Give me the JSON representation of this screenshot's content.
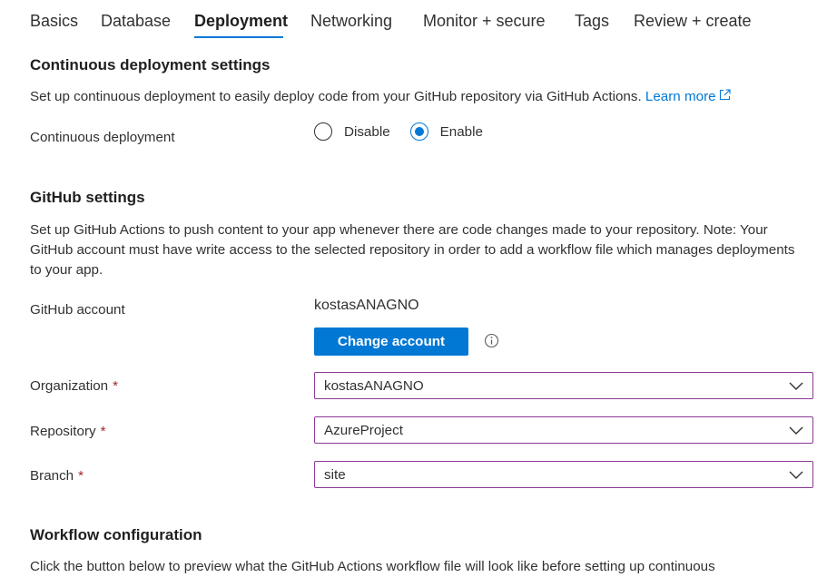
{
  "tabs": [
    {
      "label": "Basics"
    },
    {
      "label": "Database"
    },
    {
      "label": "Deployment"
    },
    {
      "label": "Networking"
    },
    {
      "label": "Monitor + secure"
    },
    {
      "label": "Tags"
    },
    {
      "label": "Review + create"
    }
  ],
  "active_tab": "Deployment",
  "accent_color": "#0078d4",
  "continuous_deployment": {
    "title": "Continuous deployment settings",
    "description": "Set up continuous deployment to easily deploy code from your GitHub repository via GitHub Actions.",
    "learn_more": "Learn more",
    "label": "Continuous deployment",
    "options": [
      {
        "label": "Disable",
        "checked": false
      },
      {
        "label": "Enable",
        "checked": true
      }
    ]
  },
  "github": {
    "title": "GitHub settings",
    "description": "Set up GitHub Actions to push content to your app whenever there are code changes made to your repository. Note: Your GitHub account must have write access to the selected repository in order to add a workflow file which manages deployments to your app.",
    "account_label": "GitHub account",
    "account_name": "kostasANAGNO",
    "change_account_label": "Change account",
    "organization": {
      "label": "Organization",
      "required_mark": "*",
      "value": "kostasANAGNO"
    },
    "repository": {
      "label": "Repository",
      "required_mark": "*",
      "value": "AzureProject"
    },
    "branch": {
      "label": "Branch",
      "required_mark": "*",
      "value": "site"
    }
  },
  "workflow": {
    "title": "Workflow configuration",
    "description": "Click the button below to preview what the GitHub Actions workflow file will look like before setting up continuous"
  }
}
